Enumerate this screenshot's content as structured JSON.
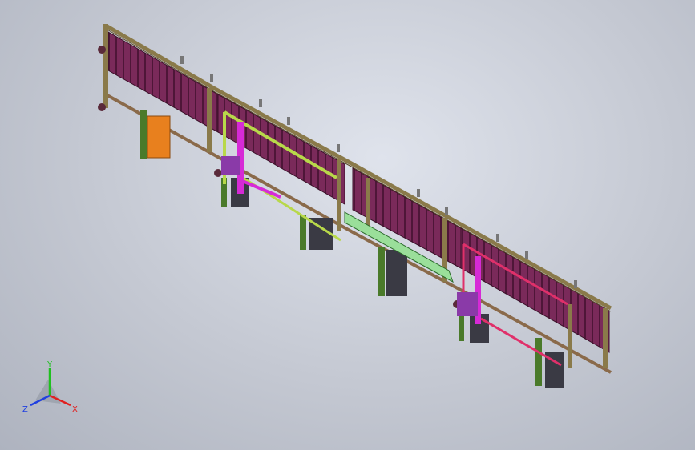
{
  "viewport": {
    "background_top": "#dfe3ec",
    "background_bottom": "#aeb3bf"
  },
  "model": {
    "frame_color": "#8a7a4a",
    "panel_color": "#7a2a5a",
    "panel_dark": "#4e1638",
    "leg_color": "#4a7a2a",
    "green_beam": "#9adf9a",
    "magenta": "#d62ad6",
    "purple": "#8a3aa8",
    "orange": "#e8801e",
    "pink_beam": "#e0306a",
    "lime_rail": "#b8d84a",
    "tan": "#c8a878"
  },
  "triad": {
    "x_label": "X",
    "y_label": "Y",
    "z_label": "Z",
    "x_color": "#e02020",
    "y_color": "#20c020",
    "z_color": "#2040e0"
  }
}
